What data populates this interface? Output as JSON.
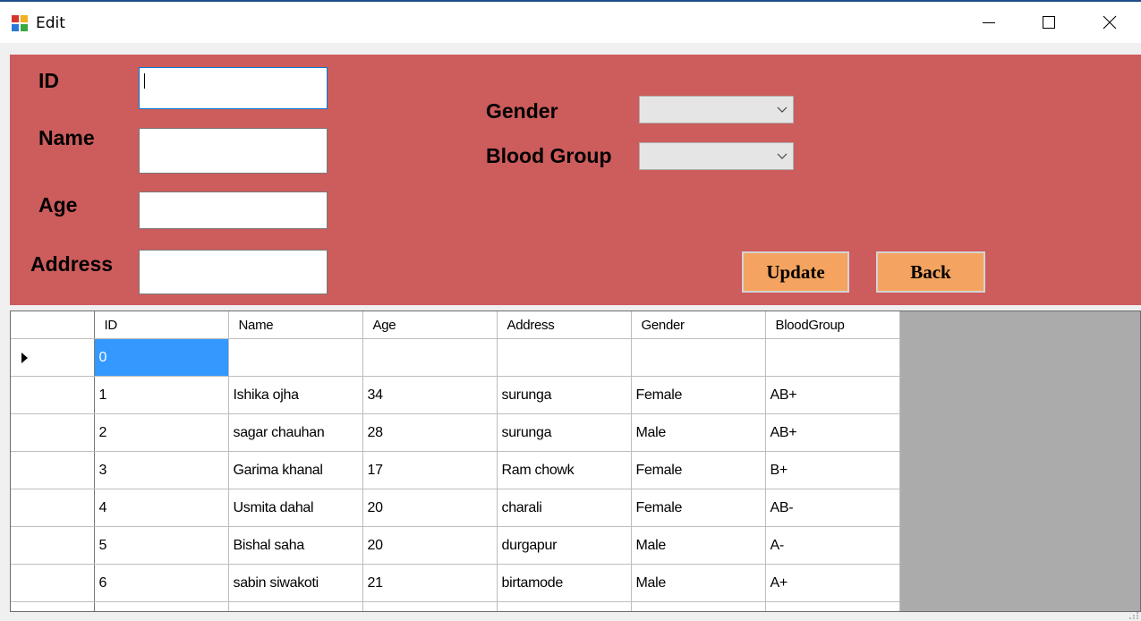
{
  "window": {
    "title": "Edit",
    "app_icon": "form-app-icon"
  },
  "form": {
    "id_label": "ID",
    "name_label": "Name",
    "age_label": "Age",
    "address_label": "Address",
    "gender_label": "Gender",
    "blood_group_label": "Blood Group",
    "id_value": "",
    "name_value": "",
    "age_value": "",
    "address_value": "",
    "gender_value": "",
    "blood_group_value": "",
    "update_label": "Update",
    "back_label": "Back"
  },
  "colors": {
    "panel": "#cd5c5c",
    "button": "#f4a460",
    "selection": "#3399ff"
  },
  "table": {
    "columns": [
      "ID",
      "Name",
      "Age",
      "Address",
      "Gender",
      "BloodGroup"
    ],
    "rows": [
      [
        "0",
        "",
        "",
        "",
        "",
        ""
      ],
      [
        "1",
        "Ishika ojha",
        "34",
        "surunga",
        "Female",
        "AB+"
      ],
      [
        "2",
        "sagar chauhan",
        "28",
        "surunga",
        "Male",
        "AB+"
      ],
      [
        "3",
        "Garima khanal",
        "17",
        "Ram chowk",
        "Female",
        "B+"
      ],
      [
        "4",
        "Usmita dahal",
        "20",
        "charali",
        "Female",
        "AB-"
      ],
      [
        "5",
        "Bishal saha",
        "20",
        "durgapur",
        "Male",
        "A-"
      ],
      [
        "6",
        "sabin siwakoti",
        "21",
        "birtamode",
        "Male",
        "A+"
      ]
    ]
  }
}
